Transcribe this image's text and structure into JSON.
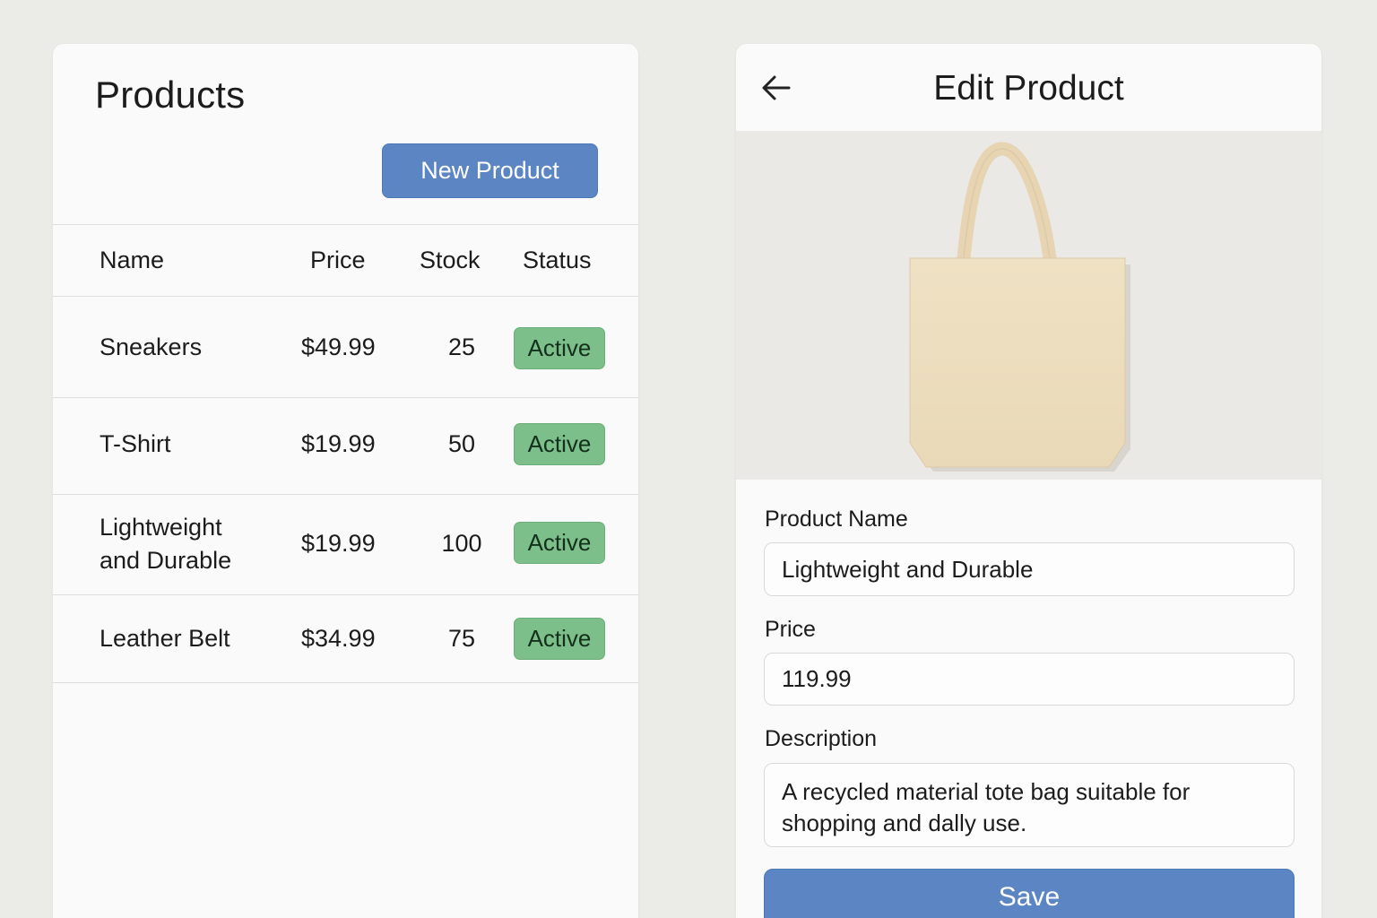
{
  "products": {
    "title": "Products",
    "new_button": "New Product",
    "columns": [
      "Name",
      "Price",
      "Stock",
      "Status"
    ],
    "rows": [
      {
        "name": "Sneakers",
        "price": "$49.99",
        "stock": "25",
        "status": "Active"
      },
      {
        "name": "T-Shirt",
        "price": "$19.99",
        "stock": "50",
        "status": "Active"
      },
      {
        "name": "Lightweight and Durable",
        "price": "$19.99",
        "stock": "100",
        "status": "Active"
      },
      {
        "name": "Leather Belt",
        "price": "$34.99",
        "stock": "75",
        "status": "Active"
      }
    ]
  },
  "edit": {
    "title": "Edit Product",
    "back_icon": "arrow-left-icon",
    "image": "tote-bag-image",
    "name_label": "Product Name",
    "name_value": "Lightweight and Durable",
    "price_label": "Price",
    "price_value": "119.99",
    "description_label": "Description",
    "description_value": "A recycled material tote bag suitable for shopping and dally use.",
    "save_button": "Save"
  },
  "colors": {
    "primary": "#5b86c3",
    "active_badge": "#7dbf8a",
    "background": "#ebebe7",
    "panel": "#fafafa"
  }
}
